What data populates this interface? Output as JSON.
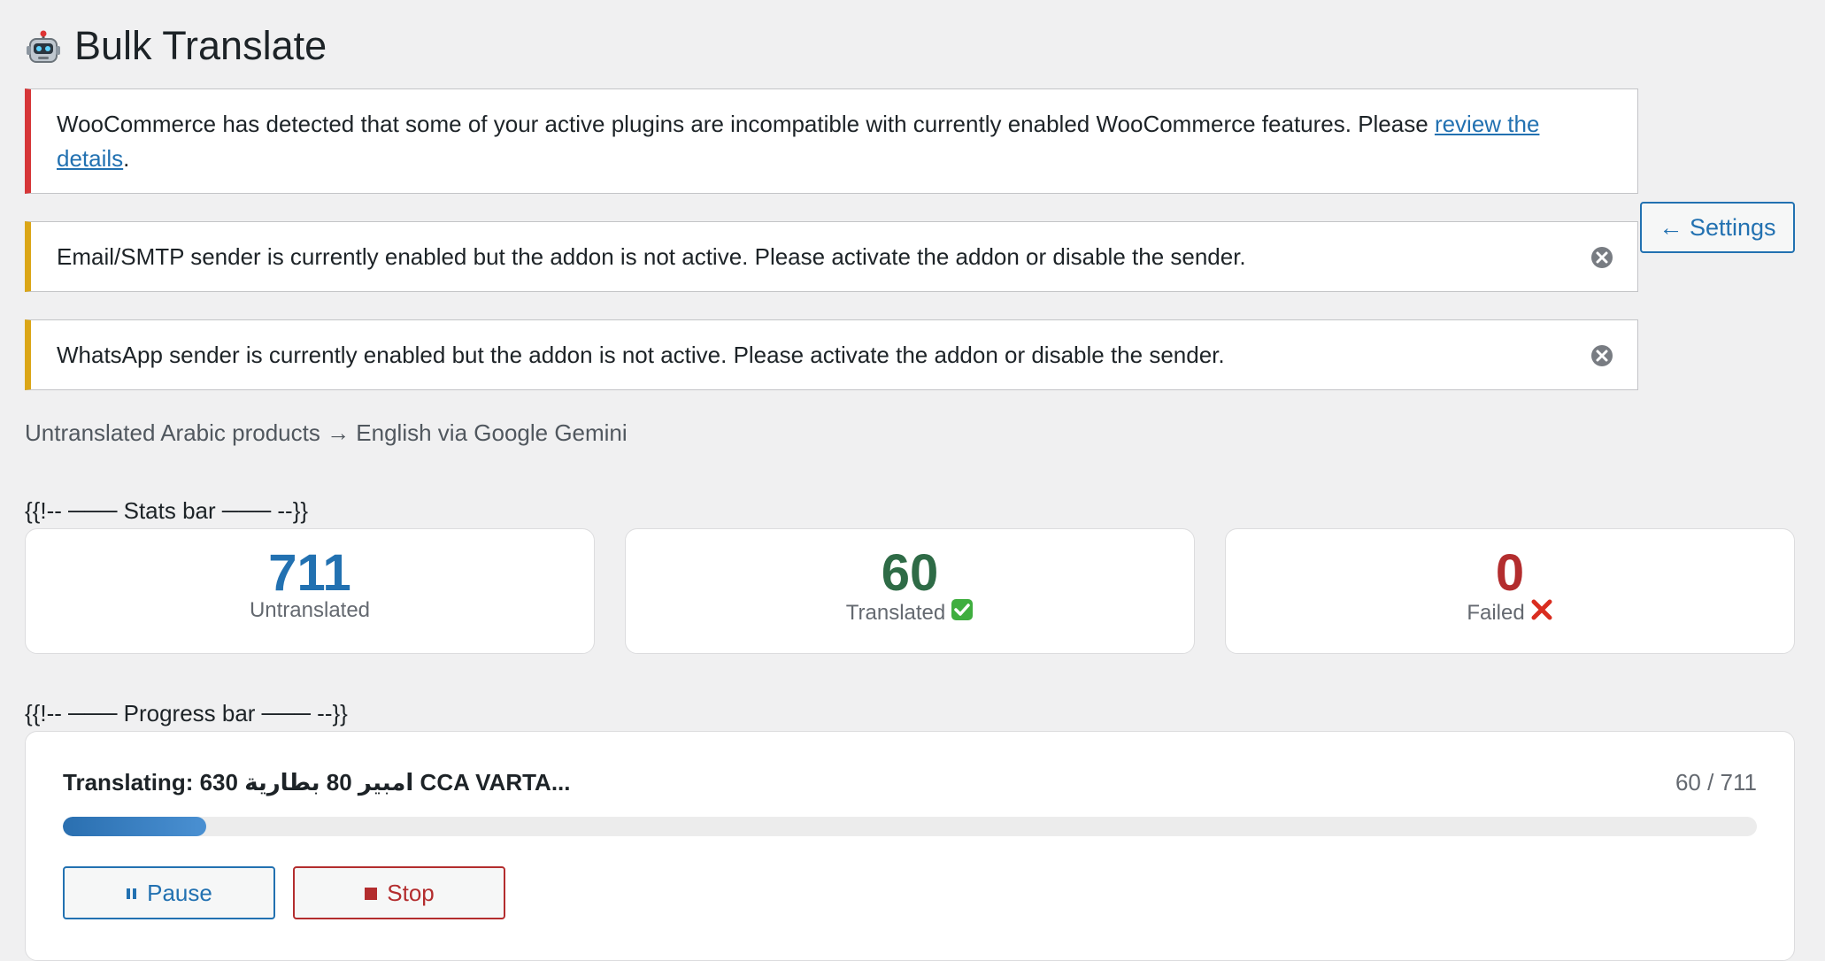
{
  "header": {
    "icon": "robot-icon",
    "title": "Bulk Translate"
  },
  "notices": {
    "error": {
      "text": "WooCommerce has detected that some of your active plugins are incompatible with currently enabled WooCommerce features. Please",
      "link": "review the details",
      "suffix": "."
    },
    "smtp": {
      "text": "Email/SMTP sender is currently enabled but the addon is not active. Please activate the addon or disable the sender."
    },
    "whatsapp": {
      "text": "WhatsApp sender is currently enabled but the addon is not active. Please activate the addon or disable the sender."
    }
  },
  "settings_button": {
    "label": "← Settings"
  },
  "subtitle": "Untranslated Arabic products → English via Google Gemini",
  "comments": {
    "stats": "{{!-- ─── Stats bar ─── --}}",
    "progress": "{{!-- ─── Progress bar ─── --}}"
  },
  "stats": [
    {
      "value": "711",
      "label": "Untranslated",
      "icon": "",
      "color": "#2271b1"
    },
    {
      "value": "60",
      "label": "Translated",
      "icon": "check-icon",
      "color": "#2e6b46"
    },
    {
      "value": "0",
      "label": "Failed",
      "icon": "cross-icon",
      "color": "#b32d2e"
    }
  ],
  "progress": {
    "label": "Translating: 630 امبير 80 بطارية CCA VARTA...",
    "count": "60 / 711",
    "fraction": 0.0844
  },
  "buttons": {
    "pause": "Pause",
    "stop": "Stop"
  }
}
